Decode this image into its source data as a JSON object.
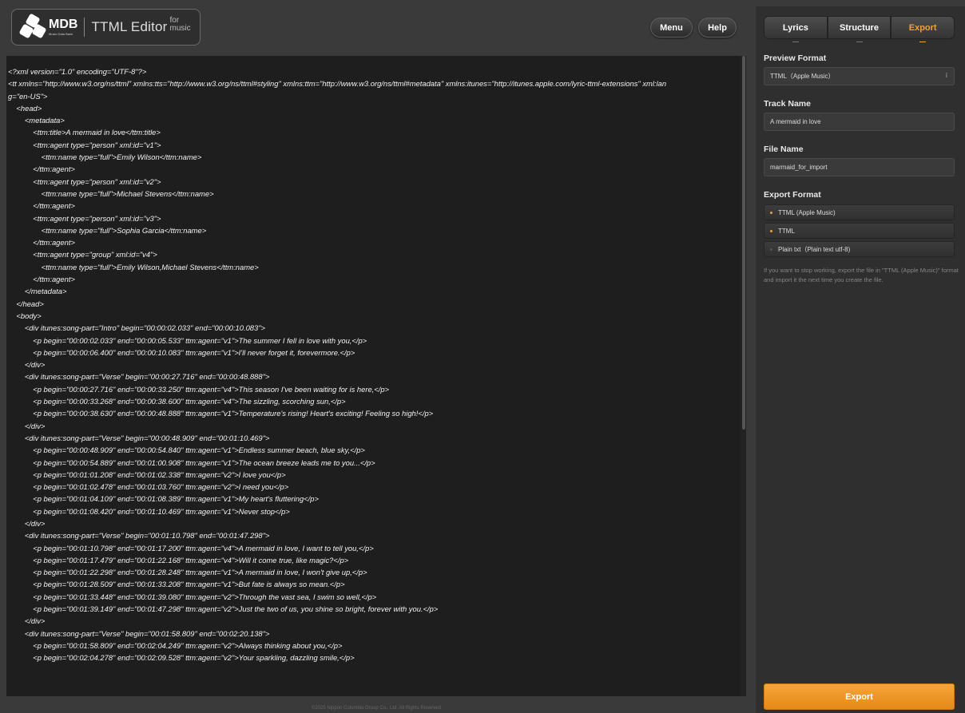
{
  "header": {
    "logo_text": "MDB",
    "logo_sub": "Music Data Bank",
    "app_title": "TTML Editor",
    "app_sub_1": "for",
    "app_sub_2": "music",
    "menu_label": "Menu",
    "help_label": "Help"
  },
  "editor": {
    "lines": [
      "<?xml version=\"1.0\" encoding=\"UTF-8\"?>",
      "<tt xmlns=\"http://www.w3.org/ns/ttml\" xmlns:tts=\"http://www.w3.org/ns/ttml#styling\" xmlns:ttm=\"http://www.w3.org/ns/ttml#metadata\" xmlns:itunes=\"http://itunes.apple.com/lyric-ttml-extensions\" xml:lan",
      "g=\"en-US\">",
      "    <head>",
      "        <metadata>",
      "            <ttm:title>A mermaid in love</ttm:title>",
      "            <ttm:agent type=\"person\" xml:id=\"v1\">",
      "                <ttm:name type=\"full\">Emily Wilson</ttm:name>",
      "            </ttm:agent>",
      "            <ttm:agent type=\"person\" xml:id=\"v2\">",
      "                <ttm:name type=\"full\">Michael Stevens</ttm:name>",
      "            </ttm:agent>",
      "            <ttm:agent type=\"person\" xml:id=\"v3\">",
      "                <ttm:name type=\"full\">Sophia Garcia</ttm:name>",
      "            </ttm:agent>",
      "            <ttm:agent type=\"group\" xml:id=\"v4\">",
      "                <ttm:name type=\"full\">Emily Wilson,Michael Stevens</ttm:name>",
      "            </ttm:agent>",
      "        </metadata>",
      "    </head>",
      "    <body>",
      "        <div itunes:song-part=\"Intro\" begin=\"00:00:02.033\" end=\"00:00:10.083\">",
      "            <p begin=\"00:00:02.033\" end=\"00:00:05.533\" ttm:agent=\"v1\">The summer I fell in love with you,</p>",
      "            <p begin=\"00:00:06.400\" end=\"00:00:10.083\" ttm:agent=\"v1\">I'll never forget it, forevermore.</p>",
      "        </div>",
      "        <div itunes:song-part=\"Verse\" begin=\"00:00:27.716\" end=\"00:00:48.888\">",
      "            <p begin=\"00:00:27.716\" end=\"00:00:33.250\" ttm:agent=\"v4\">This season I've been waiting for is here,</p>",
      "            <p begin=\"00:00:33.268\" end=\"00:00:38.600\" ttm:agent=\"v4\">The sizzling, scorching sun,</p>",
      "            <p begin=\"00:00:38.630\" end=\"00:00:48.888\" ttm:agent=\"v1\">Temperature's rising! Heart's exciting! Feeling so high!</p>",
      "        </div>",
      "        <div itunes:song-part=\"Verse\" begin=\"00:00:48.909\" end=\"00:01:10.469\">",
      "            <p begin=\"00:00:48.909\" end=\"00:00:54.840\" ttm:agent=\"v1\">Endless summer beach, blue sky,</p>",
      "            <p begin=\"00:00:54.889\" end=\"00:01:00.908\" ttm:agent=\"v1\">The ocean breeze leads me to you...</p>",
      "            <p begin=\"00:01:01.208\" end=\"00:01:02.338\" ttm:agent=\"v2\">I love you</p>",
      "            <p begin=\"00:01:02.478\" end=\"00:01:03.760\" ttm:agent=\"v2\">I need you</p>",
      "            <p begin=\"00:01:04.109\" end=\"00:01:08.389\" ttm:agent=\"v1\">My heart's fluttering</p>",
      "            <p begin=\"00:01:08.420\" end=\"00:01:10.469\" ttm:agent=\"v1\">Never stop</p>",
      "        </div>",
      "        <div itunes:song-part=\"Verse\" begin=\"00:01:10.798\" end=\"00:01:47.298\">",
      "            <p begin=\"00:01:10.798\" end=\"00:01:17.200\" ttm:agent=\"v4\">A mermaid in love, I want to tell you,</p>",
      "            <p begin=\"00:01:17.479\" end=\"00:01:22.168\" ttm:agent=\"v4\">Will it come true, like magic?</p>",
      "            <p begin=\"00:01:22.298\" end=\"00:01:28.248\" ttm:agent=\"v1\">A mermaid in love, I won't give up,</p>",
      "            <p begin=\"00:01:28.509\" end=\"00:01:33.208\" ttm:agent=\"v1\">But fate is always so mean.</p>",
      "            <p begin=\"00:01:33.448\" end=\"00:01:39.080\" ttm:agent=\"v2\">Through the vast sea, I swim so well,</p>",
      "            <p begin=\"00:01:39.149\" end=\"00:01:47.298\" ttm:agent=\"v2\">Just the two of us, you shine so bright, forever with you.</p>",
      "        </div>",
      "        <div itunes:song-part=\"Verse\" begin=\"00:01:58.809\" end=\"00:02:20.138\">",
      "            <p begin=\"00:01:58.809\" end=\"00:02:04.249\" ttm:agent=\"v2\">Always thinking about you,</p>",
      "            <p begin=\"00:02:04.278\" end=\"00:02:09.528\" ttm:agent=\"v2\">Your sparkling, dazzling smile,</p>"
    ]
  },
  "footer": {
    "text": "©2025 Nippon Columbia Group Co., Ltd. All Rights Reserved"
  },
  "panel": {
    "tabs": [
      "Lyrics",
      "Structure",
      "Export"
    ],
    "preview_format_label": "Preview Format",
    "preview_format_value": "TTML（Apple Music）",
    "track_name_label": "Track Name",
    "track_name_value": "A mermaid in love",
    "file_name_label": "File Name",
    "file_name_value": "marmaid_for_import",
    "export_format_label": "Export Format",
    "export_options": [
      "TTML (Apple Music)",
      "TTML",
      "Plain txt（Plain text utf-8)"
    ],
    "hint": "If you want to stop working, export the file in \"TTML (Apple Music)\" format and import it the next time you create the file.",
    "export_button": "Export"
  },
  "colors": {
    "accent": "#f0a040",
    "editor_bg": "#1e1e1e",
    "panel_bg": "#2f2f2f"
  }
}
